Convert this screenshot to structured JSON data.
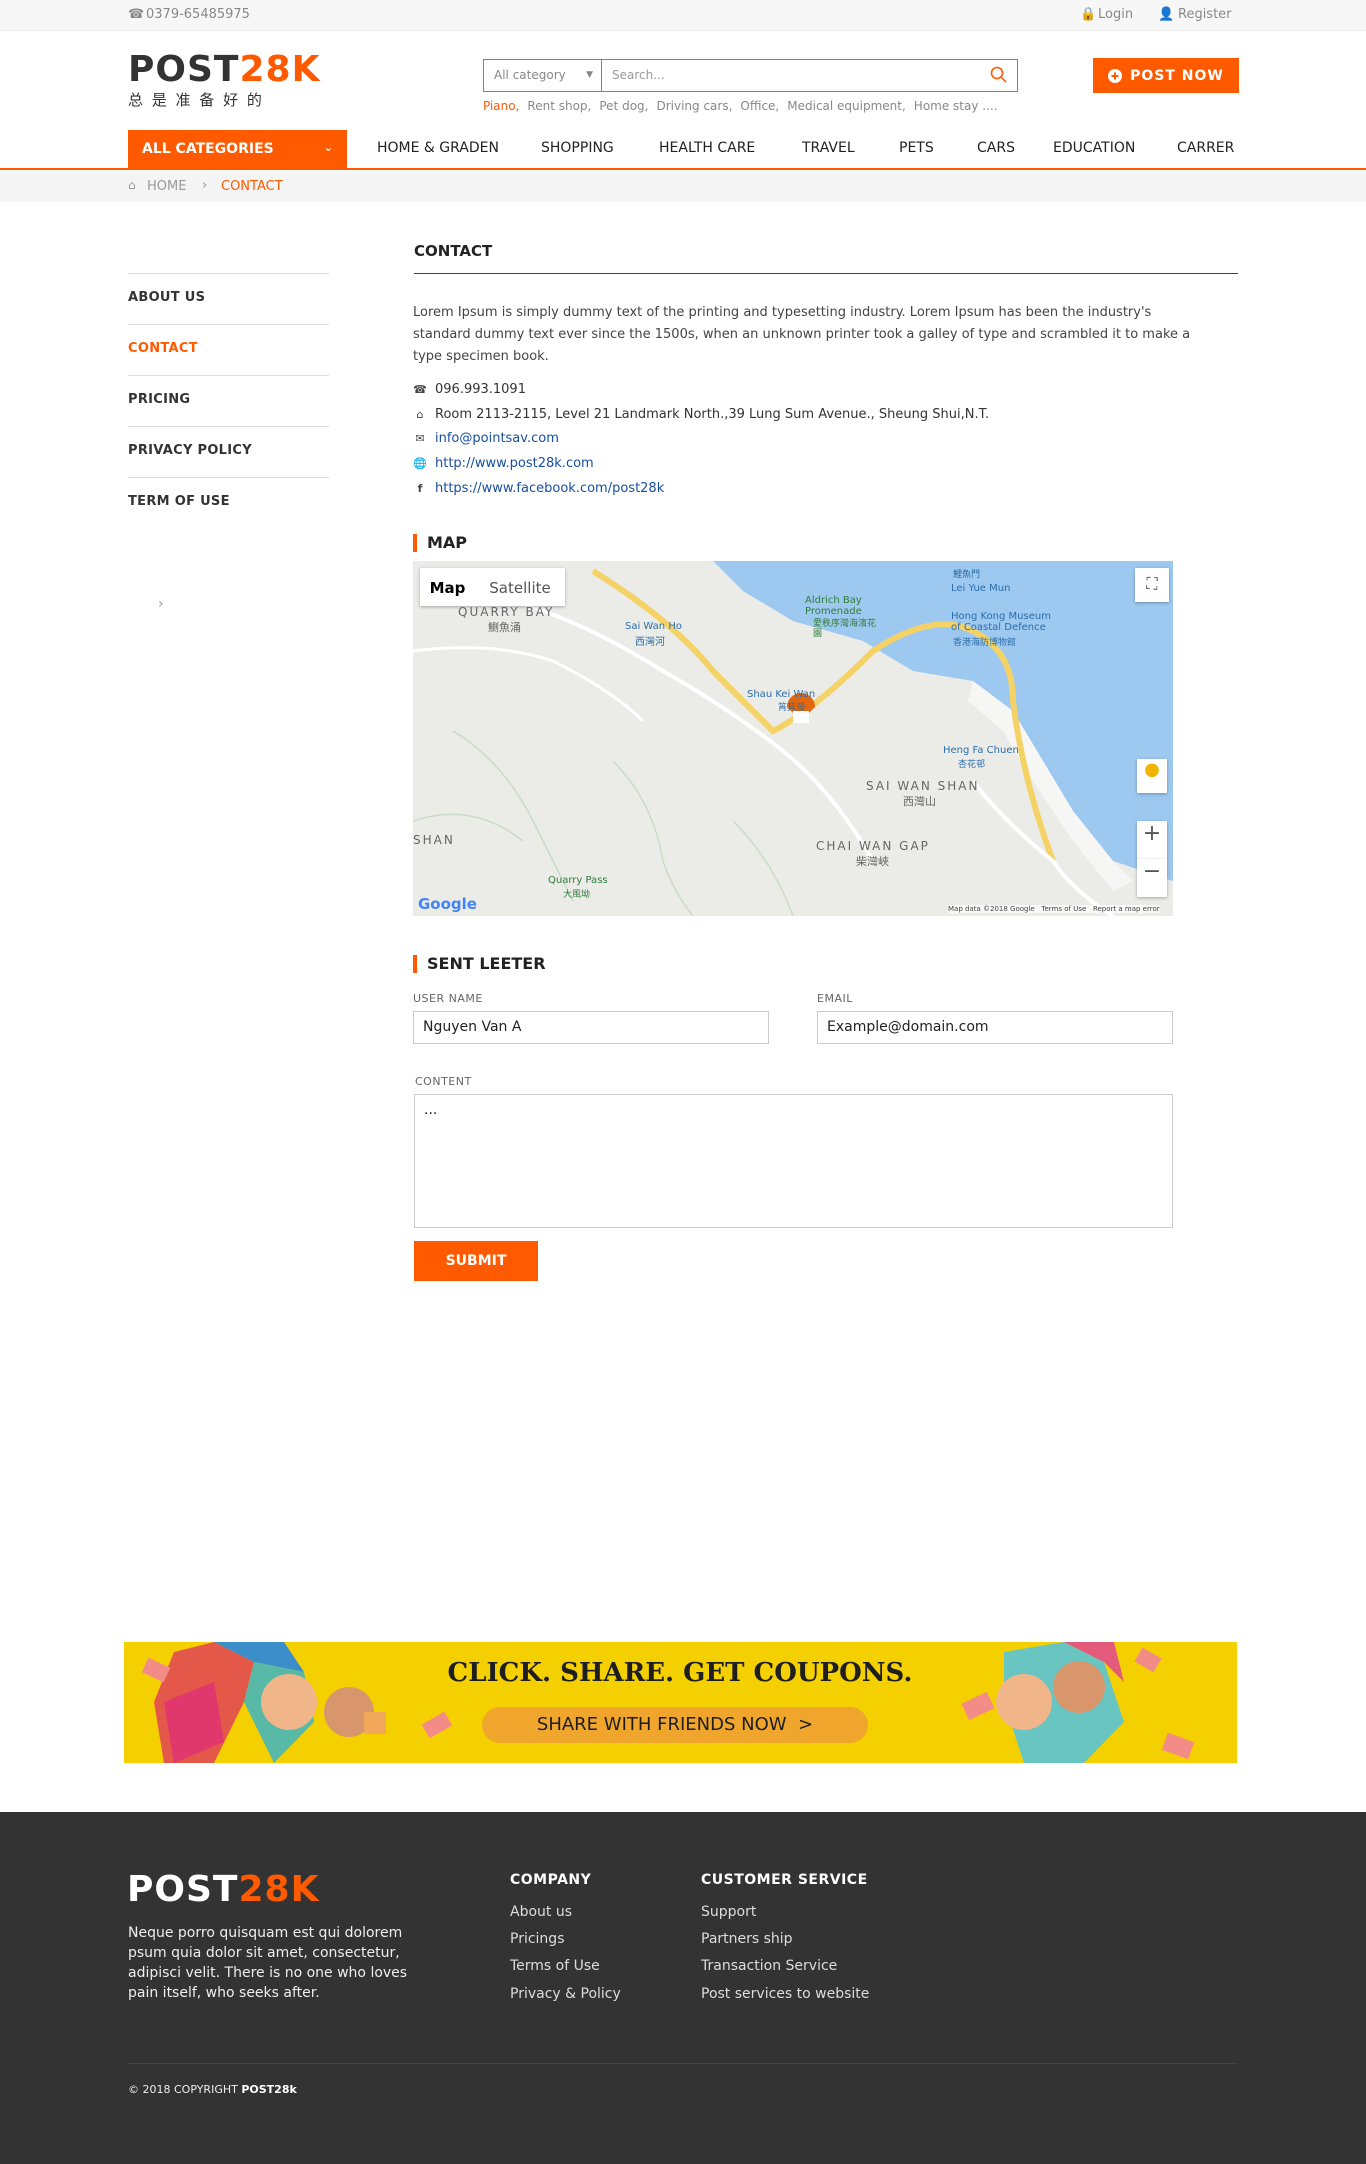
{
  "topbar": {
    "phone": "0379-65485975",
    "login": "Login",
    "register": "Register"
  },
  "logo": {
    "part1": "POST",
    "part2": "28K",
    "tagline": "总 是 准 备 好 的"
  },
  "search": {
    "category": "All category",
    "placeholder": "Search..."
  },
  "post_button": "POST NOW",
  "tags": [
    "Piano,",
    "Rent shop,",
    "Pet dog,",
    "Driving cars,",
    "Office,",
    "Medical equipment,",
    "Home stay ...."
  ],
  "nav": {
    "all_categories": "ALL CATEGORIES",
    "items": [
      "HOME & GRADEN",
      "SHOPPING",
      "HEALTH CARE",
      "TRAVEL",
      "PETS",
      "CARS",
      "EDUCATION",
      "CARRER"
    ]
  },
  "breadcrumb": {
    "home": "HOME",
    "current": "CONTACT"
  },
  "sidebar": {
    "items": [
      "ABOUT US",
      "CONTACT",
      "PRICING",
      "PRIVACY POLICY",
      "TERM OF USE"
    ]
  },
  "contact": {
    "heading": "CONTACT",
    "intro": "Lorem Ipsum is simply dummy text of the printing and typesetting industry. Lorem Ipsum has been the industry's standard dummy text ever since the 1500s, when an unknown printer took a galley of type and scrambled it to make a type specimen book.",
    "phone": "096.993.1091",
    "address": "Room 2113-2115, Level 21 Landmark North.,39 Lung Sum Avenue., Sheung Shui,N.T.",
    "email": "info@pointsav.com",
    "website": "http://www.post28k.com",
    "facebook": "https://www.facebook.com/post28k"
  },
  "map": {
    "heading": "MAP",
    "tab_map": "Map",
    "tab_satellite": "Satellite",
    "labels": [
      "QUARRY BAY",
      "鰂魚涌",
      "Sai Wan Ho",
      "西灣河",
      "Aldrich Bay Promenade",
      "愛秩序灣海濱花園",
      "Hong Kong Museum of Coastal Defence",
      "香港海防博物館",
      "Lei Yue Mun",
      "鯉魚門",
      "Shau Kei Wan",
      "筲箕灣",
      "Heng Fa Chuen",
      "杏花邨",
      "SAI WAN SHAN",
      "西灣山",
      "CHAI WAN GAP",
      "柴灣峽",
      "Quarry Pass",
      "大風坳",
      "SHAN"
    ],
    "attribution": "Map data ©2018 Google   Terms of Use   Report a map error",
    "google": "Google"
  },
  "letter": {
    "heading": "SENT LEETER",
    "user_label": "USER NAME",
    "user_value": "Nguyen Van A",
    "email_label": "EMAIL",
    "email_value": "Example@domain.com",
    "content_label": "CONTENT",
    "content_value": "...",
    "submit": "SUBMIT"
  },
  "banner": {
    "headline": "CLICK. SHARE. GET COUPONS.",
    "cta": "SHARE WITH FRIENDS NOW  >"
  },
  "footer": {
    "about": "Neque porro quisquam est qui dolorem psum quia dolor sit amet, consectetur, adipisci velit. There is no one who loves pain itself, who seeks after.",
    "company_title": "COMPANY",
    "company_links": [
      "About us",
      "Pricings",
      "Terms of Use",
      "Privacy & Policy"
    ],
    "service_title": "CUSTOMER SERVICE",
    "service_links": [
      "Support",
      "Partners ship",
      "Transaction Service",
      "Post services to website"
    ],
    "copyright": "© 2018 COPYRIGHT",
    "copyright_brand": "POST28k"
  },
  "colors": {
    "accent": "#ff5a00",
    "footer_bg": "#333333",
    "banner_bg": "#f5d000"
  }
}
